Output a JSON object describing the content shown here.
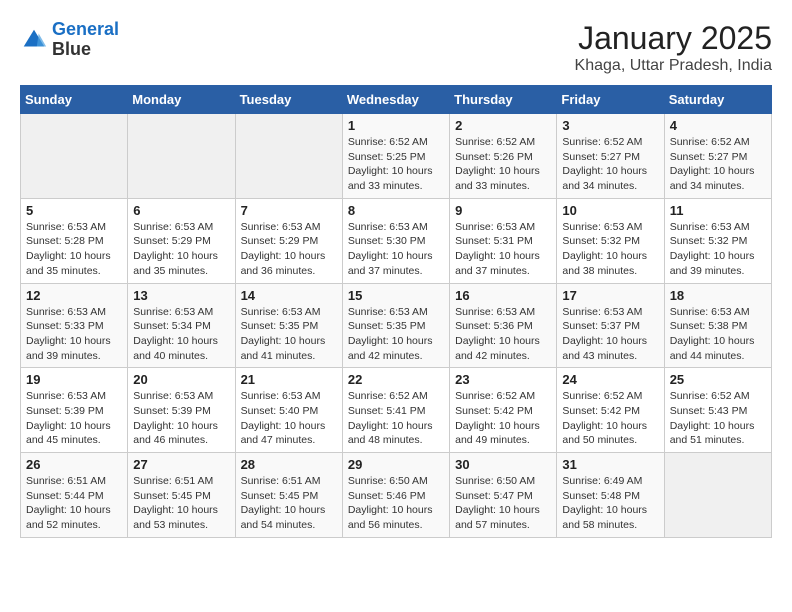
{
  "header": {
    "logo_line1": "General",
    "logo_line2": "Blue",
    "month": "January 2025",
    "location": "Khaga, Uttar Pradesh, India"
  },
  "weekdays": [
    "Sunday",
    "Monday",
    "Tuesday",
    "Wednesday",
    "Thursday",
    "Friday",
    "Saturday"
  ],
  "weeks": [
    [
      {
        "day": "",
        "info": ""
      },
      {
        "day": "",
        "info": ""
      },
      {
        "day": "",
        "info": ""
      },
      {
        "day": "1",
        "info": "Sunrise: 6:52 AM\nSunset: 5:25 PM\nDaylight: 10 hours\nand 33 minutes."
      },
      {
        "day": "2",
        "info": "Sunrise: 6:52 AM\nSunset: 5:26 PM\nDaylight: 10 hours\nand 33 minutes."
      },
      {
        "day": "3",
        "info": "Sunrise: 6:52 AM\nSunset: 5:27 PM\nDaylight: 10 hours\nand 34 minutes."
      },
      {
        "day": "4",
        "info": "Sunrise: 6:52 AM\nSunset: 5:27 PM\nDaylight: 10 hours\nand 34 minutes."
      }
    ],
    [
      {
        "day": "5",
        "info": "Sunrise: 6:53 AM\nSunset: 5:28 PM\nDaylight: 10 hours\nand 35 minutes."
      },
      {
        "day": "6",
        "info": "Sunrise: 6:53 AM\nSunset: 5:29 PM\nDaylight: 10 hours\nand 35 minutes."
      },
      {
        "day": "7",
        "info": "Sunrise: 6:53 AM\nSunset: 5:29 PM\nDaylight: 10 hours\nand 36 minutes."
      },
      {
        "day": "8",
        "info": "Sunrise: 6:53 AM\nSunset: 5:30 PM\nDaylight: 10 hours\nand 37 minutes."
      },
      {
        "day": "9",
        "info": "Sunrise: 6:53 AM\nSunset: 5:31 PM\nDaylight: 10 hours\nand 37 minutes."
      },
      {
        "day": "10",
        "info": "Sunrise: 6:53 AM\nSunset: 5:32 PM\nDaylight: 10 hours\nand 38 minutes."
      },
      {
        "day": "11",
        "info": "Sunrise: 6:53 AM\nSunset: 5:32 PM\nDaylight: 10 hours\nand 39 minutes."
      }
    ],
    [
      {
        "day": "12",
        "info": "Sunrise: 6:53 AM\nSunset: 5:33 PM\nDaylight: 10 hours\nand 39 minutes."
      },
      {
        "day": "13",
        "info": "Sunrise: 6:53 AM\nSunset: 5:34 PM\nDaylight: 10 hours\nand 40 minutes."
      },
      {
        "day": "14",
        "info": "Sunrise: 6:53 AM\nSunset: 5:35 PM\nDaylight: 10 hours\nand 41 minutes."
      },
      {
        "day": "15",
        "info": "Sunrise: 6:53 AM\nSunset: 5:35 PM\nDaylight: 10 hours\nand 42 minutes."
      },
      {
        "day": "16",
        "info": "Sunrise: 6:53 AM\nSunset: 5:36 PM\nDaylight: 10 hours\nand 42 minutes."
      },
      {
        "day": "17",
        "info": "Sunrise: 6:53 AM\nSunset: 5:37 PM\nDaylight: 10 hours\nand 43 minutes."
      },
      {
        "day": "18",
        "info": "Sunrise: 6:53 AM\nSunset: 5:38 PM\nDaylight: 10 hours\nand 44 minutes."
      }
    ],
    [
      {
        "day": "19",
        "info": "Sunrise: 6:53 AM\nSunset: 5:39 PM\nDaylight: 10 hours\nand 45 minutes."
      },
      {
        "day": "20",
        "info": "Sunrise: 6:53 AM\nSunset: 5:39 PM\nDaylight: 10 hours\nand 46 minutes."
      },
      {
        "day": "21",
        "info": "Sunrise: 6:53 AM\nSunset: 5:40 PM\nDaylight: 10 hours\nand 47 minutes."
      },
      {
        "day": "22",
        "info": "Sunrise: 6:52 AM\nSunset: 5:41 PM\nDaylight: 10 hours\nand 48 minutes."
      },
      {
        "day": "23",
        "info": "Sunrise: 6:52 AM\nSunset: 5:42 PM\nDaylight: 10 hours\nand 49 minutes."
      },
      {
        "day": "24",
        "info": "Sunrise: 6:52 AM\nSunset: 5:42 PM\nDaylight: 10 hours\nand 50 minutes."
      },
      {
        "day": "25",
        "info": "Sunrise: 6:52 AM\nSunset: 5:43 PM\nDaylight: 10 hours\nand 51 minutes."
      }
    ],
    [
      {
        "day": "26",
        "info": "Sunrise: 6:51 AM\nSunset: 5:44 PM\nDaylight: 10 hours\nand 52 minutes."
      },
      {
        "day": "27",
        "info": "Sunrise: 6:51 AM\nSunset: 5:45 PM\nDaylight: 10 hours\nand 53 minutes."
      },
      {
        "day": "28",
        "info": "Sunrise: 6:51 AM\nSunset: 5:45 PM\nDaylight: 10 hours\nand 54 minutes."
      },
      {
        "day": "29",
        "info": "Sunrise: 6:50 AM\nSunset: 5:46 PM\nDaylight: 10 hours\nand 56 minutes."
      },
      {
        "day": "30",
        "info": "Sunrise: 6:50 AM\nSunset: 5:47 PM\nDaylight: 10 hours\nand 57 minutes."
      },
      {
        "day": "31",
        "info": "Sunrise: 6:49 AM\nSunset: 5:48 PM\nDaylight: 10 hours\nand 58 minutes."
      },
      {
        "day": "",
        "info": ""
      }
    ]
  ]
}
